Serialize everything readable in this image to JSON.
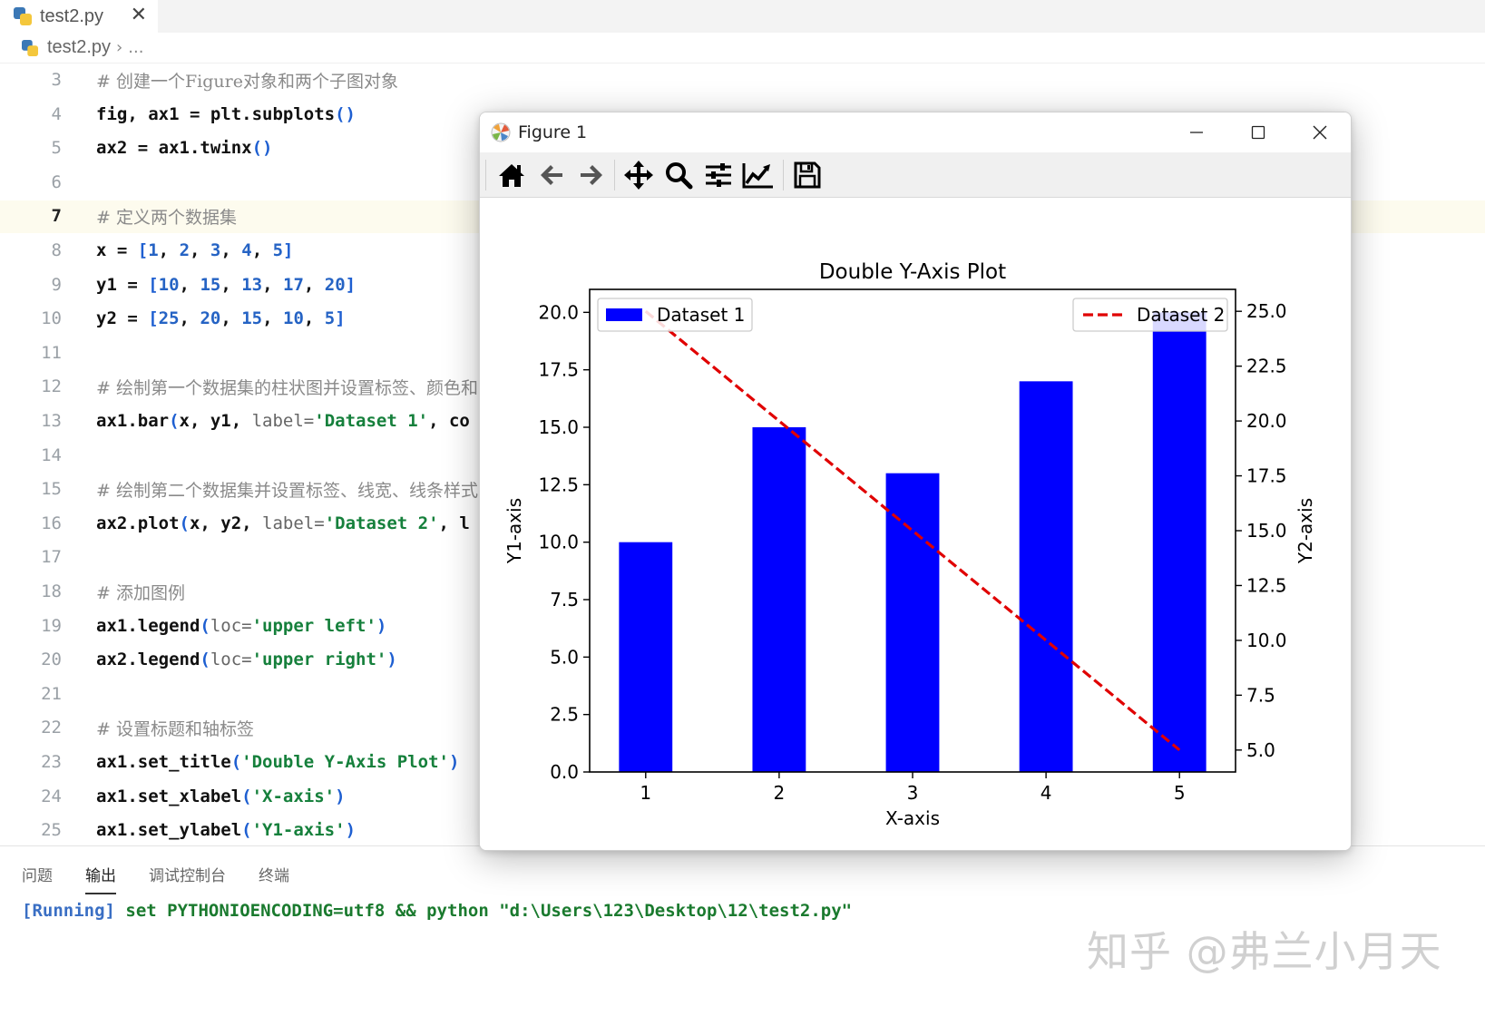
{
  "editor": {
    "tab_label": "test2.py",
    "tab_close": "✕",
    "breadcrumb": {
      "file": "test2.py",
      "sep": "›",
      "more": "..."
    }
  },
  "code_lines": [
    {
      "n": "3",
      "parts": [
        [
          "cm",
          "# 创建一个Figure对象和两个子图对象"
        ]
      ]
    },
    {
      "n": "4",
      "parts": [
        [
          "t",
          "fig, ax1 = plt.subplots"
        ],
        [
          "par",
          "()"
        ]
      ]
    },
    {
      "n": "5",
      "parts": [
        [
          "t",
          "ax2 = ax1.twinx"
        ],
        [
          "par",
          "()"
        ]
      ]
    },
    {
      "n": "6",
      "parts": []
    },
    {
      "n": "7",
      "parts": [
        [
          "cm",
          "# 定义两个数据集"
        ]
      ],
      "current": true
    },
    {
      "n": "8",
      "parts": [
        [
          "t",
          "x = "
        ],
        [
          "par",
          "["
        ],
        [
          "num",
          "1"
        ],
        [
          "t",
          ", "
        ],
        [
          "num",
          "2"
        ],
        [
          "t",
          ", "
        ],
        [
          "num",
          "3"
        ],
        [
          "t",
          ", "
        ],
        [
          "num",
          "4"
        ],
        [
          "t",
          ", "
        ],
        [
          "num",
          "5"
        ],
        [
          "par",
          "]"
        ]
      ]
    },
    {
      "n": "9",
      "parts": [
        [
          "t",
          "y1 = "
        ],
        [
          "par",
          "["
        ],
        [
          "num",
          "10"
        ],
        [
          "t",
          ", "
        ],
        [
          "num",
          "15"
        ],
        [
          "t",
          ", "
        ],
        [
          "num",
          "13"
        ],
        [
          "t",
          ", "
        ],
        [
          "num",
          "17"
        ],
        [
          "t",
          ", "
        ],
        [
          "num",
          "20"
        ],
        [
          "par",
          "]"
        ]
      ]
    },
    {
      "n": "10",
      "parts": [
        [
          "t",
          "y2 = "
        ],
        [
          "par",
          "["
        ],
        [
          "num",
          "25"
        ],
        [
          "t",
          ", "
        ],
        [
          "num",
          "20"
        ],
        [
          "t",
          ", "
        ],
        [
          "num",
          "15"
        ],
        [
          "t",
          ", "
        ],
        [
          "num",
          "10"
        ],
        [
          "t",
          ", "
        ],
        [
          "num",
          "5"
        ],
        [
          "par",
          "]"
        ]
      ]
    },
    {
      "n": "11",
      "parts": []
    },
    {
      "n": "12",
      "parts": [
        [
          "cm",
          "# 绘制第一个数据集的柱状图并设置标签、颜色和"
        ]
      ]
    },
    {
      "n": "13",
      "parts": [
        [
          "t",
          "ax1.bar"
        ],
        [
          "par",
          "("
        ],
        [
          "t",
          "x, y1, "
        ],
        [
          "kw",
          "label="
        ],
        [
          "str",
          "'Dataset 1'"
        ],
        [
          "t",
          ", co"
        ]
      ]
    },
    {
      "n": "14",
      "parts": []
    },
    {
      "n": "15",
      "parts": [
        [
          "cm",
          "# 绘制第二个数据集并设置标签、线宽、线条样式"
        ]
      ]
    },
    {
      "n": "16",
      "parts": [
        [
          "t",
          "ax2.plot"
        ],
        [
          "par",
          "("
        ],
        [
          "t",
          "x, y2, "
        ],
        [
          "kw",
          "label="
        ],
        [
          "str",
          "'Dataset 2'"
        ],
        [
          "t",
          ", l"
        ]
      ]
    },
    {
      "n": "17",
      "parts": []
    },
    {
      "n": "18",
      "parts": [
        [
          "cm",
          "# 添加图例"
        ]
      ]
    },
    {
      "n": "19",
      "parts": [
        [
          "t",
          "ax1.legend"
        ],
        [
          "par",
          "("
        ],
        [
          "kw",
          "loc="
        ],
        [
          "str",
          "'upper left'"
        ],
        [
          "par",
          ")"
        ]
      ]
    },
    {
      "n": "20",
      "parts": [
        [
          "t",
          "ax2.legend"
        ],
        [
          "par",
          "("
        ],
        [
          "kw",
          "loc="
        ],
        [
          "str",
          "'upper right'"
        ],
        [
          "par",
          ")"
        ]
      ]
    },
    {
      "n": "21",
      "parts": []
    },
    {
      "n": "22",
      "parts": [
        [
          "cm",
          "# 设置标题和轴标签"
        ]
      ]
    },
    {
      "n": "23",
      "parts": [
        [
          "t",
          "ax1.set_title"
        ],
        [
          "par",
          "("
        ],
        [
          "str",
          "'Double Y-Axis Plot'"
        ],
        [
          "par",
          ")"
        ]
      ]
    },
    {
      "n": "24",
      "parts": [
        [
          "t",
          "ax1.set_xlabel"
        ],
        [
          "par",
          "("
        ],
        [
          "str",
          "'X-axis'"
        ],
        [
          "par",
          ")"
        ]
      ]
    },
    {
      "n": "25",
      "parts": [
        [
          "t",
          "ax1.set_ylabel"
        ],
        [
          "par",
          "("
        ],
        [
          "str",
          "'Y1-axis'"
        ],
        [
          "par",
          ")"
        ]
      ]
    }
  ],
  "panel": {
    "tabs": [
      "问题",
      "输出",
      "调试控制台",
      "终端"
    ],
    "active_tab": "输出",
    "console_prefix": "[Running]",
    "console_cmd": " set PYTHONIOENCODING=utf8 && python \"d:\\Users\\123\\Desktop\\12\\test2.py\"",
    "watermark": "知乎 @弗兰小月天"
  },
  "figure_window": {
    "title": "Figure 1",
    "toolbar": [
      "home-icon",
      "back-icon",
      "forward-icon",
      "pan-icon",
      "zoom-icon",
      "configure-subplots-icon",
      "edit-axis-icon",
      "save-icon"
    ]
  },
  "chart_data": {
    "type": "bar",
    "title": "Double Y-Axis Plot",
    "xlabel": "X-axis",
    "ylabel": "Y1-axis",
    "y2label": "Y2-axis",
    "categories": [
      1,
      2,
      3,
      4,
      5
    ],
    "xlim": [
      0.58,
      5.42
    ],
    "ylim": [
      0,
      21
    ],
    "y2lim": [
      4.0,
      26.0
    ],
    "yticks": [
      "0.0",
      "2.5",
      "5.0",
      "7.5",
      "10.0",
      "12.5",
      "15.0",
      "17.5",
      "20.0"
    ],
    "y2ticks": [
      "5.0",
      "7.5",
      "10.0",
      "12.5",
      "15.0",
      "17.5",
      "20.0",
      "22.5",
      "25.0"
    ],
    "bar_width": 0.4,
    "series": [
      {
        "name": "Dataset 1",
        "kind": "bar",
        "axis": "left",
        "values": [
          10,
          15,
          13,
          17,
          20
        ],
        "color": "#0000ff"
      },
      {
        "name": "Dataset 2",
        "kind": "line",
        "axis": "right",
        "style": "dashed",
        "values": [
          25,
          20,
          15,
          10,
          5
        ],
        "color": "#e00000"
      }
    ],
    "legend": [
      "upper left",
      "upper right"
    ]
  }
}
